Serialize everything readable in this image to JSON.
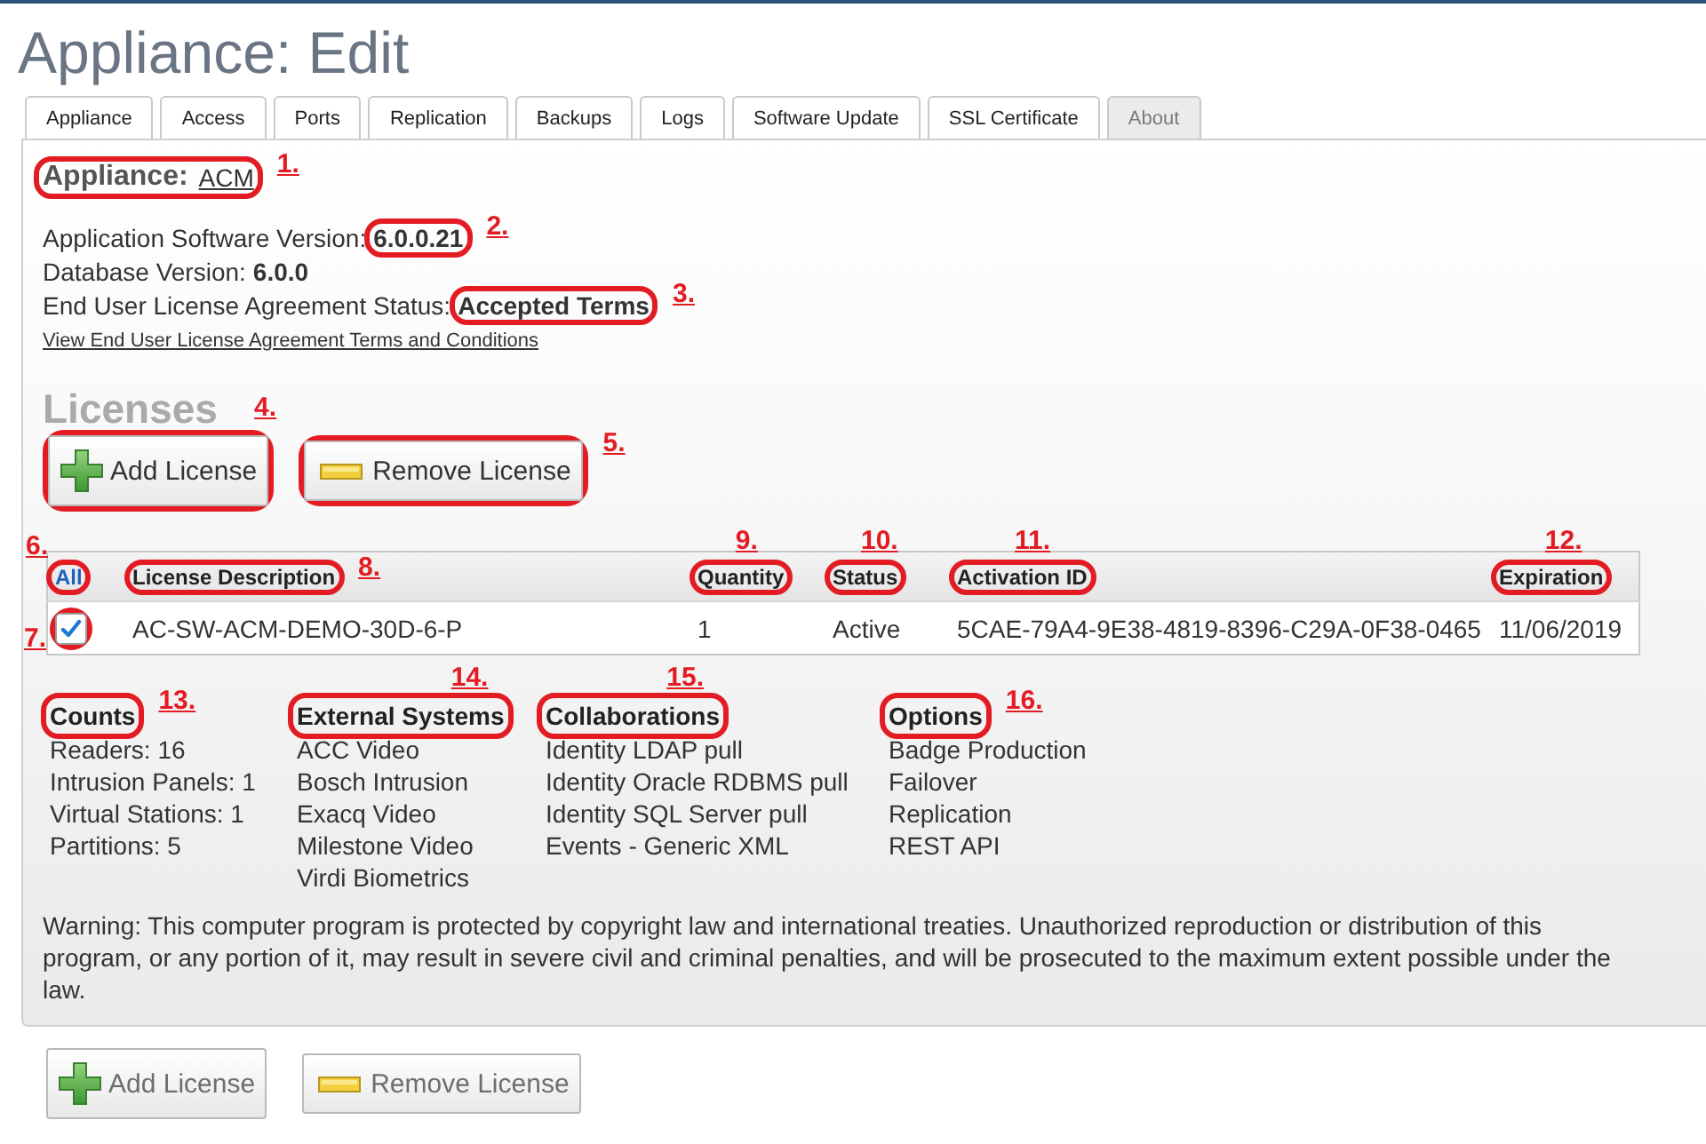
{
  "page": {
    "title": "Appliance: Edit"
  },
  "tabs": [
    {
      "label": "Appliance",
      "selected": false
    },
    {
      "label": "Access",
      "selected": false
    },
    {
      "label": "Ports",
      "selected": false
    },
    {
      "label": "Replication",
      "selected": false
    },
    {
      "label": "Backups",
      "selected": false
    },
    {
      "label": "Logs",
      "selected": false
    },
    {
      "label": "Software Update",
      "selected": false
    },
    {
      "label": "SSL Certificate",
      "selected": false
    },
    {
      "label": "About",
      "selected": true
    }
  ],
  "appliance": {
    "label": "Appliance:",
    "link": "ACM",
    "callout": "1."
  },
  "versions": [
    {
      "label": "Application Software Version:",
      "value": "6.0.0.21",
      "callout": "2."
    },
    {
      "label": "Database Version:",
      "value": "6.0.0"
    },
    {
      "label": "End User License Agreement Status:",
      "value": "Accepted Terms",
      "callout": "3."
    }
  ],
  "eula_link": "View End User License Agreement Terms and Conditions",
  "licenses": {
    "title": "Licenses",
    "actions": [
      {
        "kind": "add",
        "label": "Add License",
        "callout": "4."
      },
      {
        "kind": "remove",
        "label": "Remove License",
        "callout": "5."
      }
    ],
    "table": {
      "select_all": {
        "label": "All",
        "callout": "6."
      },
      "columns": [
        {
          "label": "License Description",
          "callout": "8."
        },
        {
          "label": "Quantity",
          "callout": "9."
        },
        {
          "label": "Status",
          "callout": "10."
        },
        {
          "label": "Activation ID",
          "callout": "11."
        },
        {
          "label": "Expiration",
          "callout": "12."
        }
      ],
      "rows": [
        {
          "checked": true,
          "callout": "7.",
          "cells": [
            "AC-SW-ACM-DEMO-30D-6-P",
            "1",
            "Active",
            "5CAE-79A4-9E38-4819-8396-C29A-0F38-0465",
            "11/06/2019"
          ]
        }
      ]
    }
  },
  "feature_groups": [
    {
      "title": "Counts",
      "callout": "13.",
      "items": [
        "Readers: 16",
        "Intrusion Panels: 1",
        "Virtual Stations: 1",
        "Partitions: 5"
      ]
    },
    {
      "title": "External Systems",
      "callout": "14.",
      "items": [
        "ACC Video",
        "Bosch Intrusion",
        "Exacq Video",
        "Milestone Video",
        "Virdi Biometrics"
      ]
    },
    {
      "title": "Collaborations",
      "callout": "15.",
      "items": [
        "Identity LDAP pull",
        "Identity Oracle RDBMS pull",
        "Identity SQL Server pull",
        "Events - Generic XML"
      ]
    },
    {
      "title": "Options",
      "callout": "16.",
      "items": [
        "Badge Production",
        "Failover",
        "Replication",
        "REST API"
      ]
    }
  ],
  "warning": "Warning: This computer program is protected by copyright law and international treaties. Unauthorized reproduction or distribution of this program, or any portion of it, may result in severe civil and criminal penalties, and will be prosecuted to the maximum extent possible under the law.",
  "footer_actions": [
    {
      "kind": "add",
      "label": "Add License"
    },
    {
      "kind": "remove",
      "label": "Remove License"
    }
  ]
}
